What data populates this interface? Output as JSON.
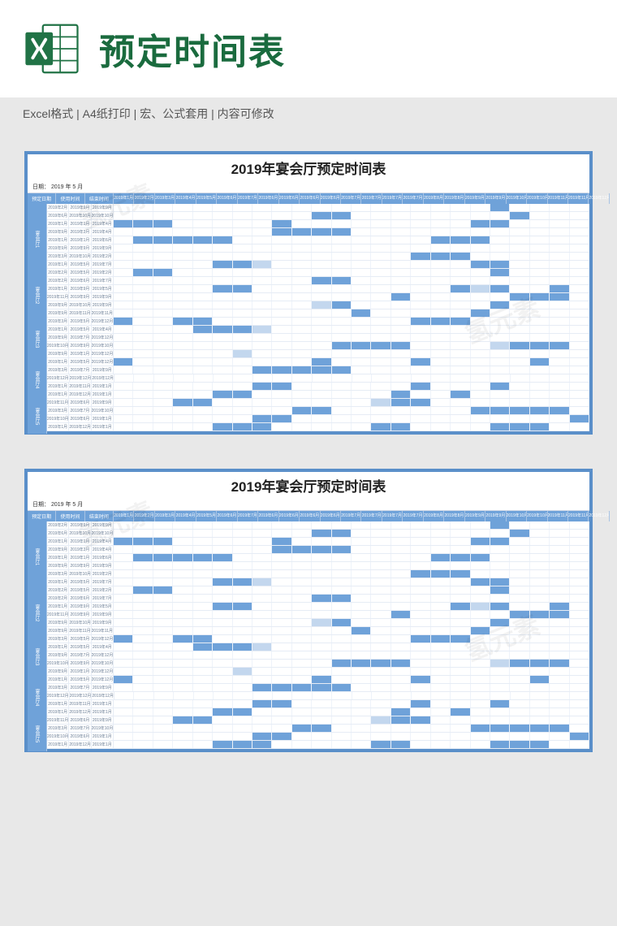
{
  "header": {
    "title": "预定时间表",
    "subtitle": "Excel格式 |  A4纸打印 | 宏、公式套用 | 内容可修改"
  },
  "sheet": {
    "title": "2019年宴会厅预定时间表",
    "date_label": "日期：   2019     年      5      月",
    "left_headers": [
      "预定日期",
      "使用时间",
      "结束时间"
    ],
    "months": [
      "2019年1月",
      "2019年2月",
      "2019年3月",
      "2019年4月",
      "2019年5月",
      "2019年6月",
      "2019年7月",
      "2019年6月",
      "2019年6月",
      "2019年6月",
      "2019年6月",
      "2019年7月",
      "2019年7月",
      "2019年7月",
      "2019年7月",
      "2019年8月",
      "2019年8月",
      "2019年9月",
      "2019年9月",
      "2019年10月",
      "2019年10月",
      "2019年11月",
      "2019年11月",
      "2019年12月"
    ],
    "groups": [
      {
        "label": "宴会厅1",
        "rows": [
          {
            "d": [
              "2019年2月",
              "2019年9月",
              "2019年9月"
            ],
            "g": "...................f...."
          },
          {
            "d": [
              "2019年6月",
              "2019年10月",
              "2019年10月"
            ],
            "g": "..........ff........f..."
          },
          {
            "d": [
              "2019年1月",
              "2019年1月",
              "2019年4月"
            ],
            "g": "fff.....f.........ff...."
          },
          {
            "d": [
              "2019年9月",
              "2019年3月",
              "2019年4月"
            ],
            "g": "........ffff............"
          },
          {
            "d": [
              "2019年1月",
              "2019年1月",
              "2019年6月"
            ],
            "g": ".fffff..........fff....."
          },
          {
            "d": [
              "2019年9月",
              "2019年9月",
              "2019年9月"
            ],
            "g": "........................"
          },
          {
            "d": [
              "2019年3月",
              "2019年10月",
              "2019年2月"
            ],
            "g": "...............fff......"
          },
          {
            "d": [
              "2019年1月",
              "2019年5月",
              "2019年7月"
            ],
            "g": ".....ffp..........ff...."
          }
        ]
      },
      {
        "label": "宴会厅2",
        "rows": [
          {
            "d": [
              "2019年2月",
              "2019年5月",
              "2019年2月"
            ],
            "g": ".ff................f...."
          },
          {
            "d": [
              "2019年2月",
              "2019年6月",
              "2019年7月"
            ],
            "g": "..........ff............"
          },
          {
            "d": [
              "2019年1月",
              "2019年9月",
              "2019年5月"
            ],
            "g": ".....ff..........fpf..f."
          },
          {
            "d": [
              "2019年11月",
              "2019年9月",
              "2019年9月"
            ],
            "g": "..............f.....fff."
          },
          {
            "d": [
              "2019年9月",
              "2019年10月",
              "2019年9月"
            ],
            "g": "..........pf.......f...."
          },
          {
            "d": [
              "2019年9月",
              "2019年11月",
              "2019年11月"
            ],
            "g": "............f.....f....."
          }
        ]
      },
      {
        "label": "宴会厅3",
        "rows": [
          {
            "d": [
              "2019年3月",
              "2019年5月",
              "2019年12月"
            ],
            "g": "f..ff..........fff......"
          },
          {
            "d": [
              "2019年1月",
              "2019年5月",
              "2019年4月"
            ],
            "g": "....fffp................"
          },
          {
            "d": [
              "2019年9月",
              "2019年7月",
              "2019年12月"
            ],
            "g": "........................"
          },
          {
            "d": [
              "2019年10月",
              "2019年9月",
              "2019年10月"
            ],
            "g": "...........ffff....pfff."
          },
          {
            "d": [
              "2019年9月",
              "2019年1月",
              "2019年12月"
            ],
            "g": "......p................."
          }
        ]
      },
      {
        "label": "宴会厅4",
        "rows": [
          {
            "d": [
              "2019年1月",
              "2019年5月",
              "2019年12月"
            ],
            "g": "f.........f....f.....f.."
          },
          {
            "d": [
              "2019年3月",
              "2019年7月",
              "2019年9月"
            ],
            "g": ".......fffff............"
          },
          {
            "d": [
              "2019年12月",
              "2019年12月",
              "2019年12月"
            ],
            "g": "........................"
          },
          {
            "d": [
              "2019年1月",
              "2019年11月",
              "2019年1月"
            ],
            "g": ".......ff......f...f...."
          },
          {
            "d": [
              "2019年1月",
              "2019年12月",
              "2019年1月"
            ],
            "g": ".....ff.......f..f......"
          }
        ]
      },
      {
        "label": "宴会厅5",
        "rows": [
          {
            "d": [
              "2019年11月",
              "2019年6月",
              "2019年9月"
            ],
            "g": "...ff........pff........"
          },
          {
            "d": [
              "2019年3月",
              "2019年7月",
              "2019年10月"
            ],
            "g": ".........ff.......fffff."
          },
          {
            "d": [
              "2019年10月",
              "2019年6月",
              "2019年1月"
            ],
            "g": ".......ff..............f"
          },
          {
            "d": [
              "2019年1月",
              "2019年12月",
              "2019年1月"
            ],
            "g": ".....fff.....ff....fff.."
          }
        ]
      }
    ]
  },
  "watermark": "氢元素"
}
